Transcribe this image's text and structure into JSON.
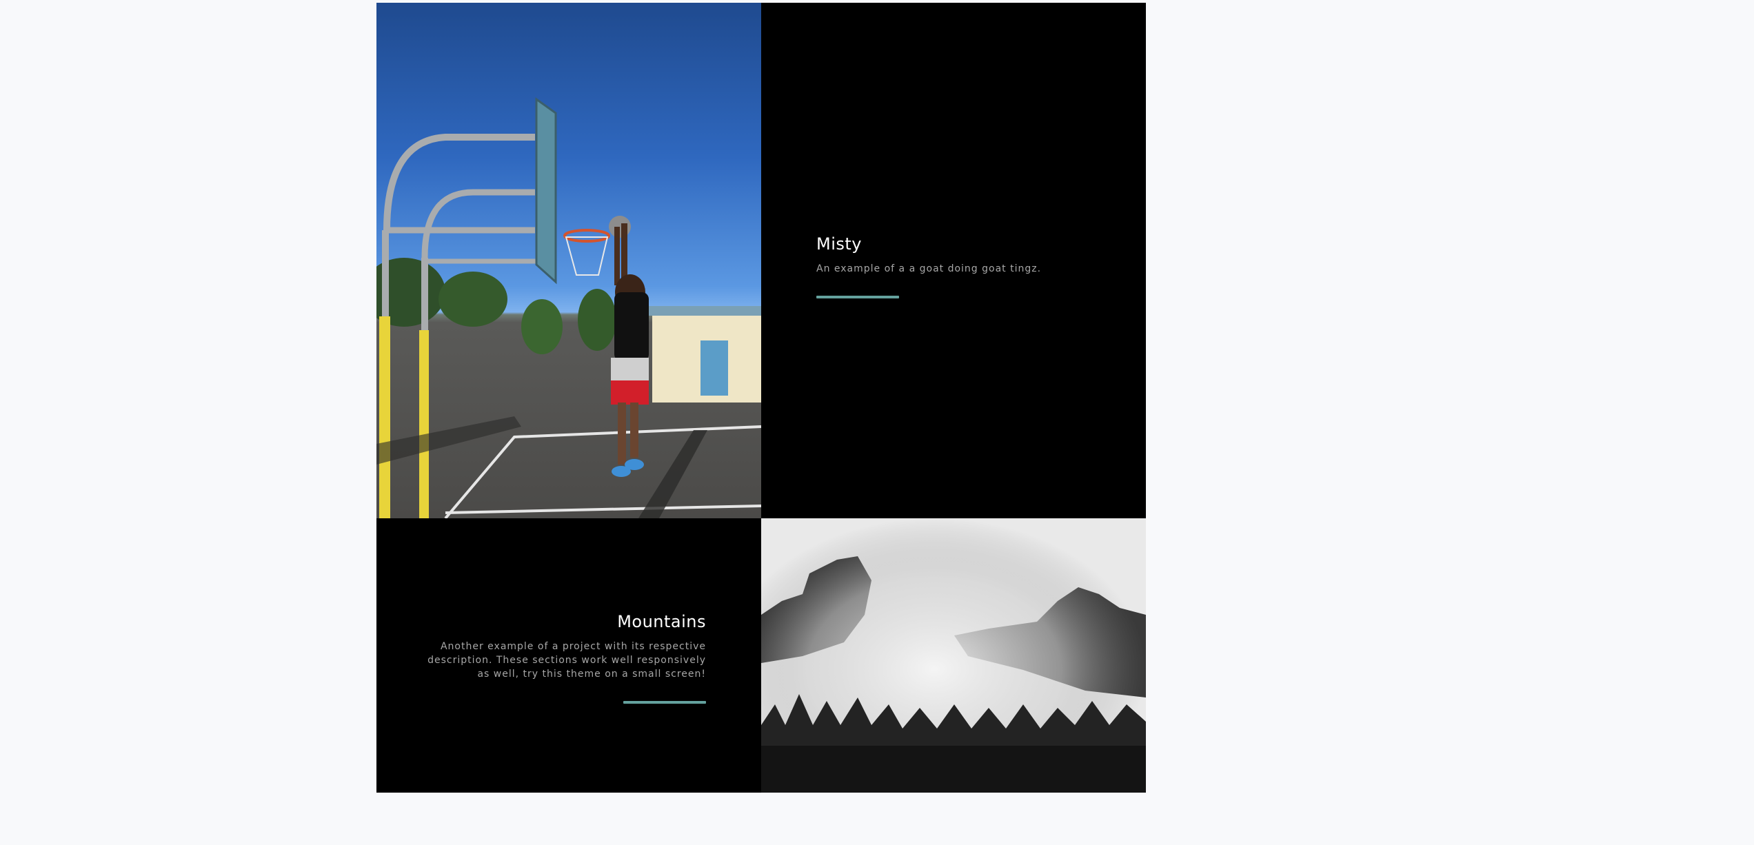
{
  "colors": {
    "page_background": "#f8f9fb",
    "panel_background": "#000000",
    "accent": "#64a19d",
    "title_text": "#ffffff",
    "description_text": "#a7a7a7"
  },
  "projects": [
    {
      "title": "Misty",
      "description": "An example of a a goat doing goat tingz."
    },
    {
      "title": "Mountains",
      "description": "Another example of a project with its respective description. These sections work well responsively as well, try this theme on a small screen!"
    }
  ]
}
